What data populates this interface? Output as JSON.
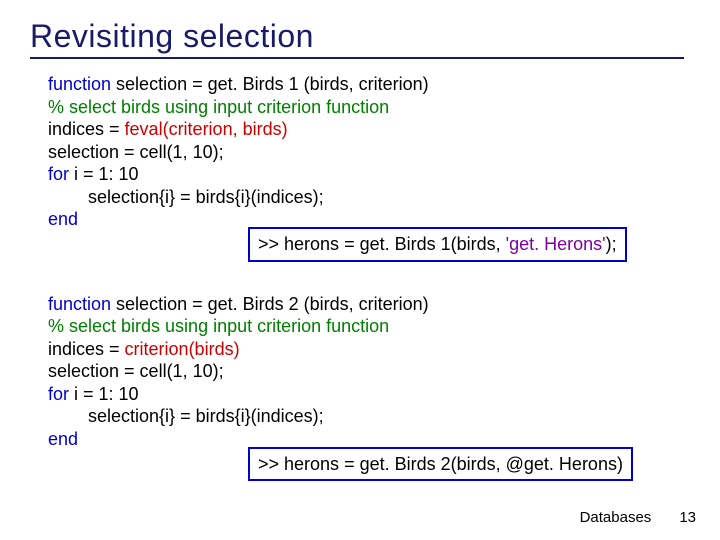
{
  "title": "Revisiting selection",
  "block1": {
    "l1_a": "function ",
    "l1_b": "selection = get. Birds 1 (birds, criterion)",
    "l2": "% select birds using input criterion function",
    "l3_a": "indices = ",
    "l3_b": "feval(criterion, birds)",
    "l4": "selection = cell(1, 10);",
    "l5_a": "for ",
    "l5_b": "i = 1: 10",
    "l6": "selection{i} = birds{i}(indices);",
    "l7": "end"
  },
  "example1": {
    "a": ">> herons = get. Birds 1(birds, ",
    "b": "'get. Herons'",
    "c": ");"
  },
  "block2": {
    "l1_a": "function ",
    "l1_b": "selection = get. Birds 2 (birds, criterion)",
    "l2": "% select birds using input criterion function",
    "l3_a": "indices = ",
    "l3_b": "criterion(birds)",
    "l4": "selection = cell(1, 10);",
    "l5_a": "for ",
    "l5_b": "i = 1: 10",
    "l6": "selection{i} = birds{i}(indices);",
    "l7": "end"
  },
  "example2": {
    "a": ">> herons = get. Birds 2(birds, @get. Herons)"
  },
  "footer": {
    "label": "Databases",
    "page": "13"
  }
}
